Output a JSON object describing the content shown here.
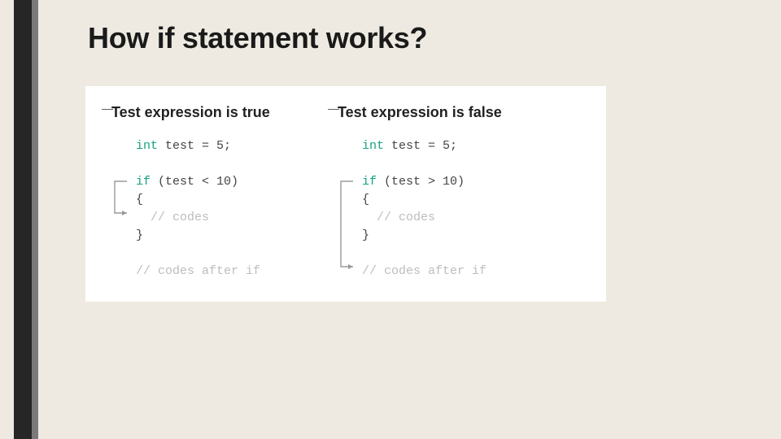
{
  "title": "How if statement works?",
  "left": {
    "heading": "Test expression is true",
    "l1a": "int",
    "l1b": " test = 5;",
    "l2a": "if",
    "l2b": " (test < 10)",
    "l3": "{",
    "l4": "  // codes",
    "l5": "}",
    "l6": "// codes after if"
  },
  "right": {
    "heading": "Test expression is false",
    "l1a": "int",
    "l1b": " test = 5;",
    "l2a": "if",
    "l2b": " (test > 10)",
    "l3": "{",
    "l4": "  // codes",
    "l5": "}",
    "l6": "// codes after if"
  }
}
